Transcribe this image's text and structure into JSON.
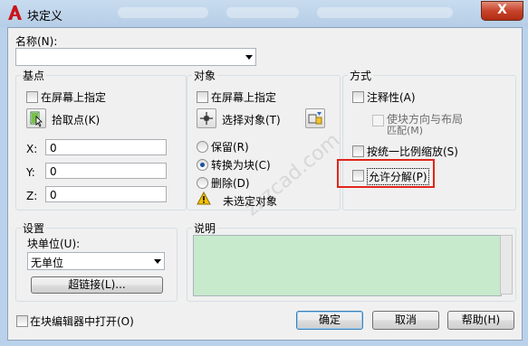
{
  "window": {
    "title": "块定义",
    "close_label": "X"
  },
  "name_field": {
    "label": "名称(N):",
    "value": ""
  },
  "base_point": {
    "title": "基点",
    "specify_on_screen": "在屏幕上指定",
    "pick_point": "拾取点(K)",
    "x_label": "X:",
    "x_value": "0",
    "y_label": "Y:",
    "y_value": "0",
    "z_label": "Z:",
    "z_value": "0"
  },
  "objects": {
    "title": "对象",
    "specify_on_screen": "在屏幕上指定",
    "select_objects": "选择对象(T)",
    "retain": "保留(R)",
    "convert_to_block": "转换为块(C)",
    "delete": "删除(D)",
    "none_selected": "未选定对象"
  },
  "behavior": {
    "title": "方式",
    "annotative": "注释性(A)",
    "match_orientation_line1": "使块方向与布局",
    "match_orientation_line2": "匹配(M)",
    "scale_uniformly": "按统一比例缩放(S)",
    "allow_exploding": "允许分解(P)"
  },
  "settings": {
    "title": "设置",
    "block_unit_label": "块单位(U):",
    "block_unit_value": "无单位",
    "hyperlink": "超链接(L)..."
  },
  "description": {
    "title": "说明",
    "value": ""
  },
  "footer": {
    "open_in_editor": "在块编辑器中打开(O)",
    "ok": "确定",
    "cancel": "取消",
    "help": "帮助(H)"
  },
  "colors": {
    "description_bg": "#c7e9cc",
    "highlight_box": "#e1251b",
    "radio_selected": "#1c4fa0",
    "warning_icon": "#f5c400"
  },
  "watermark": {
    "text": "zzzcad.com"
  }
}
